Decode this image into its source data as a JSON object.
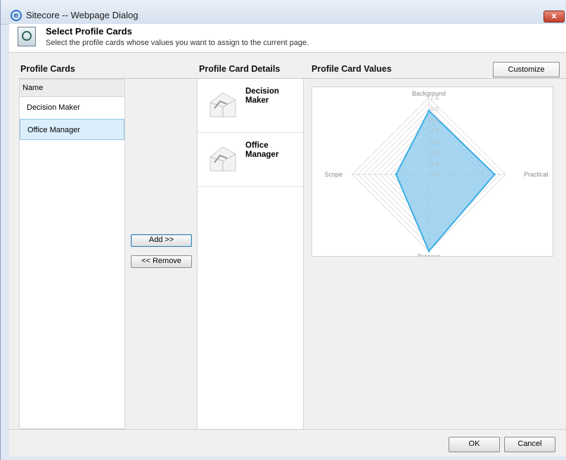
{
  "window": {
    "title": "Sitecore -- Webpage Dialog",
    "close_label": "x"
  },
  "header": {
    "title": "Select Profile Cards",
    "subtitle": "Select the profile cards whose values you want to assign to the current page."
  },
  "sections": {
    "profile_cards": "Profile Cards",
    "profile_card_details": "Profile Card Details",
    "profile_card_values": "Profile Card Values"
  },
  "customize_label": "Customize",
  "list": {
    "column_header": "Name",
    "items": [
      {
        "label": "Decision Maker",
        "selected": false
      },
      {
        "label": "Office Manager",
        "selected": true
      }
    ]
  },
  "buttons": {
    "add": "Add >>",
    "remove": "<< Remove",
    "ok": "OK",
    "cancel": "Cancel"
  },
  "details": {
    "cards": [
      {
        "name": "Decision Maker"
      },
      {
        "name": "Office Manager"
      }
    ]
  },
  "chart_data": {
    "type": "radar",
    "axes": [
      "Background",
      "Practical",
      "Process",
      "Scope"
    ],
    "scale_ticks": [
      "0.0",
      "1.0",
      "2.0",
      "3.0",
      "4.0",
      "5.0",
      "6.0",
      "7.0"
    ],
    "range": [
      0,
      7
    ],
    "series": [
      {
        "values": [
          5.8,
          6.0,
          7.0,
          3.0
        ]
      }
    ],
    "colors": {
      "fill": "#88c8ec",
      "stroke": "#3aaee6",
      "grid": "#d8d8d8"
    }
  }
}
